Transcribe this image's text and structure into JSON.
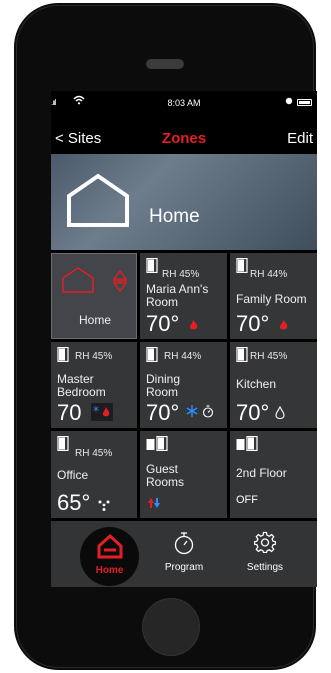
{
  "status_bar": {
    "signal": ".ııl",
    "time": "8:03 AM"
  },
  "nav": {
    "back_label": "< Sites",
    "title": "Zones",
    "edit_label": "Edit"
  },
  "hero": {
    "label": "Home"
  },
  "zones": [
    {
      "name": "Home",
      "rh": "",
      "temp": "",
      "mode": "selected"
    },
    {
      "name": "Maria Ann's Room",
      "rh": "RH 45%",
      "temp": "70°",
      "mode": "heat"
    },
    {
      "name": "Family Room",
      "rh": "RH 44%",
      "temp": "70°",
      "mode": "heat"
    },
    {
      "name": "Master Bedroom",
      "rh": "RH 45%",
      "temp": "70",
      "mode": "cool-heat"
    },
    {
      "name": "Dining Room",
      "rh": "RH 44%",
      "temp": "70°",
      "mode": "cool-timer"
    },
    {
      "name": "Kitchen",
      "rh": "RH 45%",
      "temp": "70°",
      "mode": "humidity"
    },
    {
      "name": "Office",
      "rh": "RH 45%",
      "temp": "65°",
      "mode": "fan"
    },
    {
      "name": "Guest Rooms",
      "rh": "",
      "temp": "",
      "mode": "auto"
    },
    {
      "name": "2nd Floor",
      "rh": "",
      "temp": "",
      "status": "OFF",
      "mode": "off"
    }
  ],
  "tabbar": {
    "home_label": "Home",
    "program_label": "Program",
    "settings_label": "Settings"
  },
  "colors": {
    "accent": "#e31e24",
    "cool": "#2f8fff",
    "tile": "#353638"
  }
}
